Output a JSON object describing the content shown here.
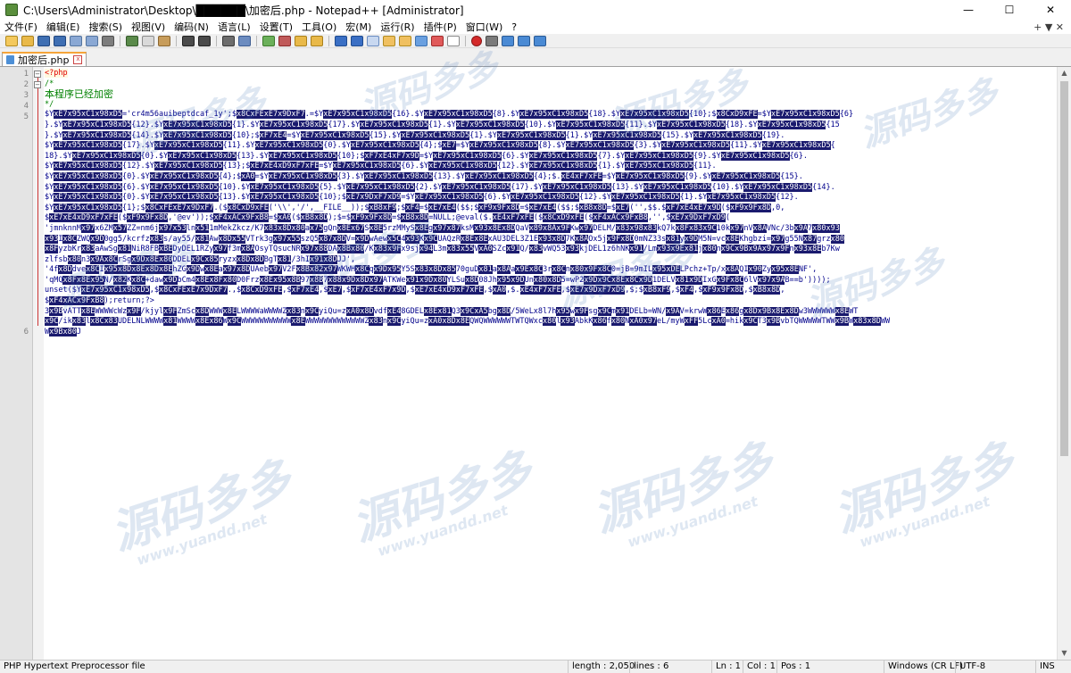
{
  "window": {
    "title": "C:\\Users\\Administrator\\Desktop\\██████\\加密后.php - Notepad++ [Administrator]",
    "minimize": "—",
    "maximize": "☐",
    "close": "✕"
  },
  "menu": {
    "items": [
      "文件(F)",
      "编辑(E)",
      "搜索(S)",
      "视图(V)",
      "编码(N)",
      "语言(L)",
      "设置(T)",
      "工具(O)",
      "宏(M)",
      "运行(R)",
      "插件(P)",
      "窗口(W)",
      "?"
    ],
    "right_label": "+ ▼ ✕"
  },
  "tab": {
    "label": "加密后.php",
    "close": "x"
  },
  "editor": {
    "line_numbers": [
      "1",
      "2",
      "3",
      "4",
      "5",
      "6"
    ],
    "line1": "<?php",
    "line2": "/*",
    "line3": "本程序已经加密",
    "line4": "*/",
    "line5_rows": [
      "$YxE7x95xC1x98xD5='cr4m56auibeptdcaf_1y';$x8CxFExE7x9DxF7.=$YxE7x95xC1x98xD5{16}.$YxE7x95xC1x98xD5{8}.$YxE7x95xC1x98xD5{18}.$YxE7x95xC1x98xD5{10};$x8CxD9xFE=$YxE7x95xC1x98xD5{6}",
      "}.$YxE7x95xC1x98xD5{12}.$YxE7x95xC1x98xD5{1}.$YxE7x95xC1x98xD5{17}.$YxE7x95xC1x98xD5{1}.$YxE7x95xC1x98xD5{10}.$YxE7x95xC1x98xD5{11}.$YxE7x95xC1x98xD5{18}.$YxE7x95xC1x98xD5{15",
      "}.$YxE7x95xC1x98xD5{14}.$YxE7x95xC1x98xD5{10};$xF7xE4=$YxE7x95xC1x98xD5{15}.$YxE7x95xC1x98xD5{1}.$YxE7x95xC1x98xD5{1}.$YxE7x95xC1x98xD5{15}.$YxE7x95xC1x98xD5{19}.",
      "$YxE7x95xC1x98xD5{17}.$YxE7x95xC1x98xD5{11}.$YxE7x95xC1x98xD5{0}.$YxE7x95xC1x98xD5{4};$xE7=$YxE7x95xC1x98xD5{8}.$YxE7x95xC1x98xD5{3}.$YxE7x95xC1x98xD5{11}.$YxE7x95xC1x98xD5{",
      "18}.$YxE7x95xC1x98xD5{0}.$YxE7x95xC1x98xD5{13}.$YxE7x95xC1x98xD5{10};$xF7xE4xF7x9D=$YxE7x95xC1x98xD5{6}.$YxE7x95xC1x98xD5{7}.$YxE7x95xC1x98xD5{9}.$YxE7x95xC1x98xD5{6}.",
      "$YxE7x95xC1x98xD5{12}.$YxE7x95xC1x98xD5{13};$xE7xE4xD9xF7xFE=$YxE7x95xC1x98xD5{6}.$YxE7x95xC1x98xD5{12}.$YxE7x95xC1x98xD5{1}.$YxE7x95xC1x98xD5{11}.",
      "$YxE7x95xC1x98xD5{0}.$YxE7x95xC1x98xD5{4};$xA0=$YxE7x95xC1x98xD5{3}.$YxE7x95xC1x98xD5{13}.$YxE7x95xC1x98xD5{4};$.xE4xF7xFE=$YxE7x95xC1x98xD5{9}.$YxE7x95xC1x98xD5{15}.",
      "$YxE7x95xC1x98xD5{6}.$YxE7x95xC1x98xD5{10}.$YxE7x95xC1x98xD5{5}.$YxE7x95xC1x98xD5{2}.$YxE7x95xC1x98xD5{17}.$YxE7x95xC1x98xD5{13}.$YxE7x95xC1x98xD5{10}.$YxE7x95xC1x98xD5{14}.",
      "$YxE7x95xC1x98xD5{0}.$YxE7x95xC1x98xD5{13}.$YxE7x95xC1x98xD5{10};$xE7x9DxF7xD9=$YxE7x95xC1x98xD5{6}.$YxE7x95xC1x98xD5{12}.$YxE7x95xC1x98xD5{1}.$YxE7x95xC1x98xD5{12}.",
      "$YxE7x95xC1x98xD5{1};$x8CxFExE7x9DxF7.($x8CxD9xFE('\\\\','/',__FILE__));$xB8xF9;$xF4=$xE7xE4($$;$xF9x9Fx8D=$xE7xE4($$;$xB8x8D=$xE7('',$$.$xF7xE4xE7x9D($xF9x9Fx8D,0,",
      "$xE7xE4xD9xF7xFE($xF9x9Fx8D,'@ev'));$xF4xACx9FxB8=$xA0($xB8x8D);$=$xF9x9Fx8D=$xB8x8D=NULL;@eval($.xE4xF7xFE($x8CxD9xFE($xF4xACx9FxB8,'',$xE7x9DxF7xD9(",
      "'jmnknnMx97x6ZMx57ZZ=nm6jx97x53lnx511mMekZkcz/K7x83x8Dx80ax75gQnx8Ex67Sx8E5rzMMySx8Egx97x87ksMx93x8Ex8DQaVx89x8Ax9FKwx97DELM/x83x98x83kQ7kx8Fx83x9C10kx97nVx8AVNc/3bx9A7x80x93",
      "x93Ix8CZWQx9D0gg5/kcrfzx83s/ay55/x81Awx8Dx55VTrk3gx97x55szQ5x87x8DV=x9DwAewx5C4x93Kx9CUAQzRx8Ex8ExAU3DEL3Z1Ex93x8D7Kx8AOx5jx9Fx8D0mNZ33sx81yx9DM5N=vcx8EKhgbzi=x97g55Nx87grzx80",
      "x8FyzbKrx83aAwSgx81NiR8FBxBEDyDEL1RZyx97f3mx8AOsyTQsucNRx97x88DAx8Bx80/Kx83x9Fx9sjx94L3mx83x55VxA0SZcx91Q/x83vWQ53x93kjDEL1z6hNKx91/Lmx93x9Ex81jx80nx9Cx9Bx9Ax97x9Fnx93x8Eb7Kw",
      "zlfsbx80n3x9Ax8CrSgx9Dx8Ex80DDELx9Cx85ryzxx8Dx8DBgTx81/3hIx91x8DJJ',",
      "'4fx8Ddvex8CIx95x8Dx8Ex8Dx8EhZGx9Dwx8Eax97x8DUAebx97V2Fx8Bx82x97WKWHx8Cqx9Dx95Y5Sx83x8Dx8570guDx81ax8Aax9Ex8C3rx8Cnx80x9Fx8C0=jB=9mILx95xDELPchz+Tp/xx8AQIx90Zyx95x8ENF',",
      "'qMQx8Fx8Ex95N/x82Kx8C+dawx9DbCm4x8Ex8Fx80D0Frzx8Ex95x8B97x8B7x88x9Dx8Dx97ATKWex91x9Dx80YLSux8D08Jhx95x9DUnx80x8D5=wP2x9Dx9Cx8Ex8Cx9D1DELVx81x9DIxGx9Fx8C6lVx97x9AB==b'))));",
      "unset($YxE7x95xC1x98xD5,$x8CxFExE7x9DxF7.,$x8CxD9xFE,$xF7xE4,$xE7,$xF7xE4xF7x9D,$xE7xE4xD9xF7xFE,$xA0,$.xE4xF7xFE,$xE7x9DxF7xD9,$;$xB8xF9,$xF4,$xF9x9Fx8D,$xB8x8D,",
      "$xF4xACx9FxB8);return;?>"
    ],
    "line6_rows": [
      "3x9BvATTx8EWWWWcWzx9F/kjylx9FZmScx8DWWWx8ELWWWWaWWWWZx83nx9CyiQu=zxA0x8DvdfxE48GDELx8Ex81Q3x9CxA5bgx8D/5WeLx8l7hx95wx9Fsgx9Cmx91DELb=WN/x9AV=krwWx86Ex86gx8Dx9Bx8Ex8Dw3WWWWWWx8EWT",
      "x9C/ikx83lx8Cx83UDELNLWWWWx81WWWWx8Ex86Wx9CWWWWWWWWWWWx8EWWWWWWWWWWWWWZx83nx9CyiQu=zxA0x8Dx8EQWQWWWWWWTWTQWxcx80lx93AbkKx86fx80NxA0x97eL/myWxFF5LcxA0=hikx9CT3x9BvbTQWWWWWTWWx9BWx83x8DWW",
      "Wx9Bx80J"
    ]
  },
  "status": {
    "language": "PHP Hypertext Preprocessor file",
    "length": "length : 2,050",
    "lines": "lines : 6",
    "ln": "Ln : 1",
    "col": "Col : 1",
    "pos": "Pos : 1",
    "eol": "Windows (CR LF)",
    "encoding": "UTF-8",
    "mode": "INS"
  },
  "watermark": {
    "text": "源码多多",
    "sub": "YuanDD.Net",
    "url": "www.yuandd.net"
  }
}
